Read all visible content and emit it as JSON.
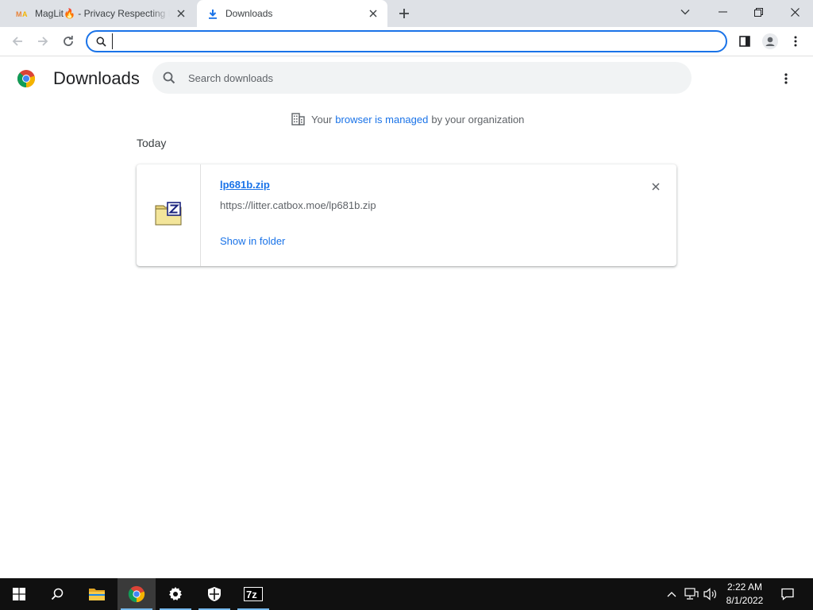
{
  "browser": {
    "tabs": [
      {
        "title": "MagLit🔥 - Privacy Respecting Er",
        "favicon": "maglit-logo",
        "active": false
      },
      {
        "title": "Downloads",
        "favicon": "download-icon",
        "active": true
      }
    ],
    "address_bar": {
      "value": "",
      "placeholder": ""
    }
  },
  "downloads_page": {
    "title": "Downloads",
    "search_placeholder": "Search downloads",
    "managed_notice": {
      "prefix": "Your",
      "link": "browser is managed",
      "suffix": "by your organization"
    },
    "date_group": "Today",
    "items": [
      {
        "file_name": "lp681b.zip",
        "url": "https://litter.catbox.moe/lp681b.zip",
        "action": "Show in folder",
        "icon": "zip-file-icon"
      }
    ]
  },
  "taskbar": {
    "pinned": [
      "start",
      "search",
      "file-explorer",
      "chrome",
      "settings",
      "windows-security",
      "7zip"
    ],
    "active_app": "chrome",
    "clock": {
      "time": "2:22 AM",
      "date": "8/1/2022"
    }
  },
  "colors": {
    "accent": "#1a73e8",
    "tabstrip": "#dee1e6",
    "taskbar": "#101010"
  }
}
